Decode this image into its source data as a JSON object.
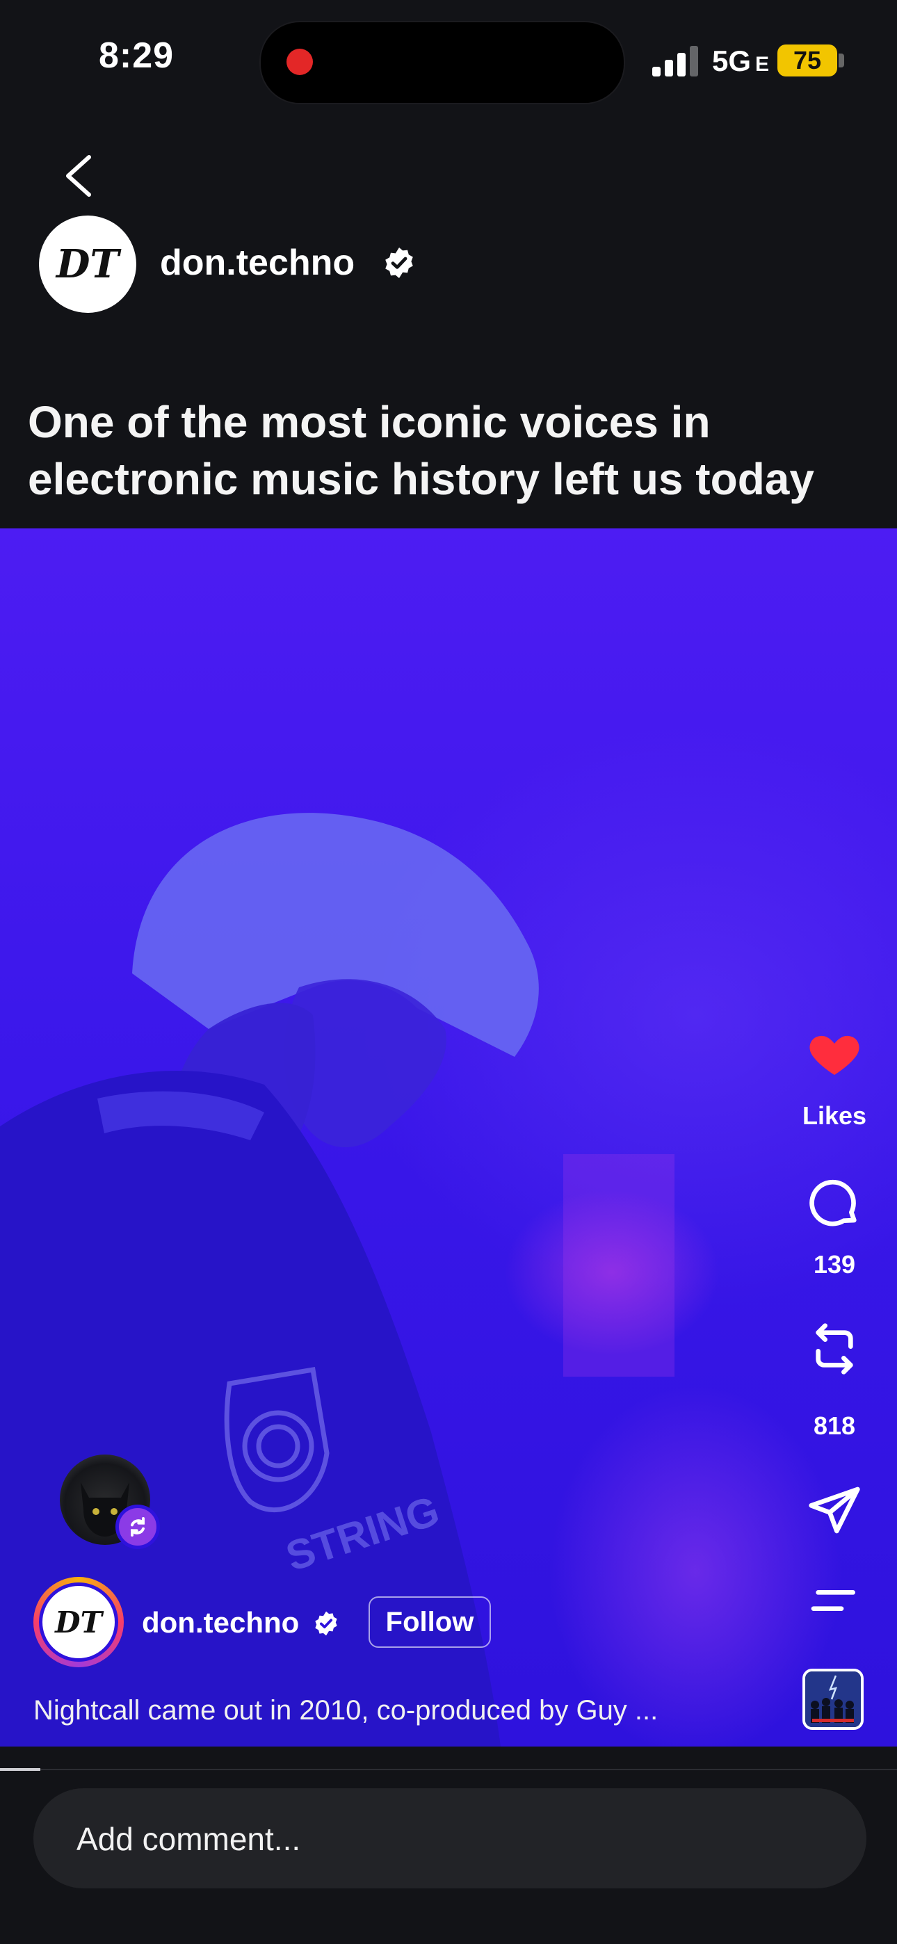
{
  "status_bar": {
    "time": "8:29",
    "network": "5G",
    "network_suffix": "E",
    "battery": "75"
  },
  "post": {
    "author": {
      "username": "don.techno",
      "avatar_monogram": "DT",
      "verified": true
    },
    "headline": "One of the most iconic voices in electronic music history left us today",
    "caption": "Nightcall came out in 2010, co-produced by Guy ...",
    "follow_label": "Follow"
  },
  "actions": {
    "likes_label": "Likes",
    "comments_count": "139",
    "reposts_count": "818"
  },
  "comment_bar": {
    "placeholder": "Add comment..."
  },
  "colors": {
    "like": "#ff2d3d",
    "video_tint": "#3a17ea",
    "remix_badge": "#8b3be6"
  },
  "icons": [
    "back-chevron-icon",
    "verified-badge-icon",
    "heart-icon",
    "comment-bubble-icon",
    "repost-icon",
    "share-send-icon",
    "more-menu-icon",
    "remix-icon"
  ]
}
